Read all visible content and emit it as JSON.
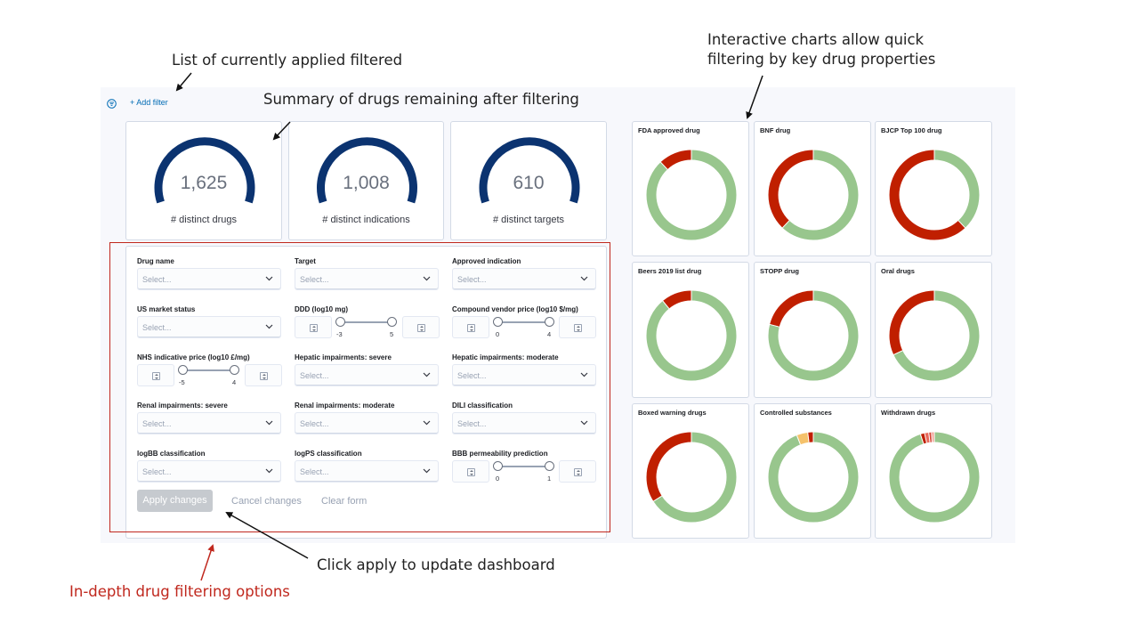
{
  "annotations": {
    "filters_list": "List of currently applied filtered",
    "summary": "Summary of drugs remaining after filtering",
    "charts_line1": "Interactive charts allow quick",
    "charts_line2": "filtering by key drug properties",
    "apply": "Click apply to update dashboard",
    "filter_options": "In-depth drug filtering options"
  },
  "colors": {
    "accent": "#006bb4",
    "gauge": "#0b3370",
    "green": "#98c68d",
    "red": "#c01f00",
    "annotation_red": "#c0281e",
    "highlight_border": "#c0281e"
  },
  "filter_bar": {
    "add_filter": "+ Add filter",
    "filter_icon": "filter-icon"
  },
  "metrics": [
    {
      "value": "1,625",
      "label": "# distinct drugs"
    },
    {
      "value": "1,008",
      "label": "# distinct indications"
    },
    {
      "value": "610",
      "label": "# distinct targets"
    }
  ],
  "form": {
    "placeholder": "Select...",
    "labels": {
      "drug_name": "Drug name",
      "target": "Target",
      "approved_indication": "Approved indication",
      "us_market_status": "US market status",
      "ddd": "DDD (log10 mg)",
      "compound_vendor_price": "Compound vendor price (log10 $/mg)",
      "nhs_price": "NHS indicative price (log10 £/mg)",
      "hepatic_severe": "Hepatic impairments: severe",
      "hepatic_moderate": "Hepatic impairments: moderate",
      "renal_severe": "Renal impairments: severe",
      "renal_moderate": "Renal impairments: moderate",
      "dili": "DILI classification",
      "logbb": "logBB classification",
      "logps": "logPS classification",
      "bbb": "BBB permeability prediction"
    },
    "ranges": {
      "ddd": {
        "min": "-3",
        "max": "5"
      },
      "vendor": {
        "min": "0",
        "max": "4"
      },
      "nhs": {
        "min": "-5",
        "max": "4"
      },
      "bbb": {
        "min": "0",
        "max": "1"
      }
    },
    "buttons": {
      "apply": "Apply changes",
      "cancel": "Cancel changes",
      "clear": "Clear form"
    }
  },
  "chart_data": [
    {
      "type": "pie",
      "title": "FDA approved drug",
      "values": [
        88,
        12
      ],
      "colors": [
        "#98c68d",
        "#c01f00"
      ]
    },
    {
      "type": "pie",
      "title": "BNF drug",
      "values": [
        62,
        38
      ],
      "colors": [
        "#98c68d",
        "#c01f00"
      ]
    },
    {
      "type": "pie",
      "title": "BJCP Top 100 drug",
      "values": [
        38,
        62
      ],
      "colors": [
        "#98c68d",
        "#c01f00"
      ]
    },
    {
      "type": "pie",
      "title": "Beers 2019 list drug",
      "values": [
        89,
        11
      ],
      "colors": [
        "#98c68d",
        "#c01f00"
      ]
    },
    {
      "type": "pie",
      "title": "STOPP drug",
      "values": [
        79,
        21
      ],
      "colors": [
        "#98c68d",
        "#c01f00"
      ]
    },
    {
      "type": "pie",
      "title": "Oral drugs",
      "values": [
        68,
        32
      ],
      "colors": [
        "#98c68d",
        "#c01f00"
      ]
    },
    {
      "type": "pie",
      "title": "Boxed warning drugs",
      "values": [
        66,
        34
      ],
      "colors": [
        "#98c68d",
        "#c01f00"
      ]
    },
    {
      "type": "pie",
      "title": "Controlled substances",
      "values": [
        94,
        4,
        2
      ],
      "colors": [
        "#98c68d",
        "#f5c26b",
        "#c01f00"
      ]
    },
    {
      "type": "pie",
      "title": "Withdrawn drugs",
      "values": [
        95,
        1.5,
        1.5,
        1,
        1
      ],
      "colors": [
        "#98c68d",
        "#c01f00",
        "#e8685a",
        "#d64a3a",
        "#f1a196"
      ]
    }
  ]
}
